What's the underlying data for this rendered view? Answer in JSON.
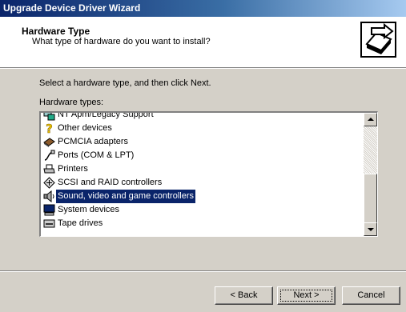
{
  "window": {
    "title": "Upgrade Device Driver Wizard"
  },
  "header": {
    "title": "Hardware Type",
    "subtitle": "What type of hardware do you want to install?"
  },
  "body": {
    "instruction": "Select a hardware type, and then click Next.",
    "list_label": "Hardware types:"
  },
  "hardware_types": [
    {
      "label": "NT Apm/Legacy Support",
      "icon": "computer-board-icon"
    },
    {
      "label": "Other devices",
      "icon": "question-mark-icon"
    },
    {
      "label": "PCMCIA adapters",
      "icon": "pcmcia-card-icon"
    },
    {
      "label": "Ports (COM & LPT)",
      "icon": "port-cable-icon"
    },
    {
      "label": "Printers",
      "icon": "printer-icon"
    },
    {
      "label": "SCSI and RAID controllers",
      "icon": "scsi-icon"
    },
    {
      "label": "Sound, video and game controllers",
      "icon": "speaker-icon",
      "selected": true
    },
    {
      "label": "System devices",
      "icon": "monitor-icon"
    },
    {
      "label": "Tape drives",
      "icon": "tape-drive-icon"
    }
  ],
  "buttons": {
    "back": "< Back",
    "next": "Next >",
    "cancel": "Cancel"
  }
}
